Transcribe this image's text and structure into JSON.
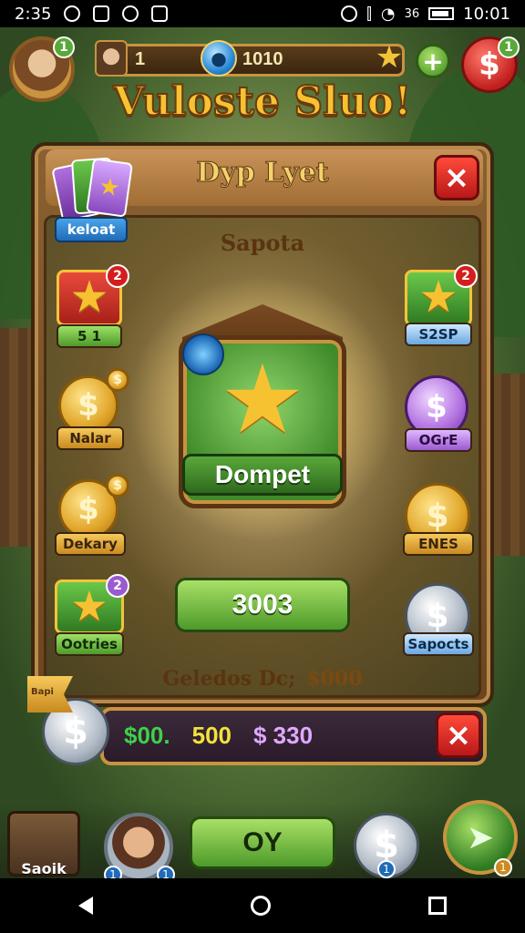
{
  "statusbar": {
    "time": "2:35",
    "clock": "10:01",
    "signal_text": "36"
  },
  "hud": {
    "level": "1",
    "gems": "1010",
    "notif_count": "1",
    "plus_symbol": "+",
    "premium_symbol": "$"
  },
  "title": "Vuloste Sluo!",
  "panel": {
    "title": "Dyp Lyet",
    "subtitle": "Sapota",
    "close_symbol": "×",
    "deck_label": "keloat"
  },
  "items_left": [
    {
      "label": "5  1",
      "badge": "2"
    },
    {
      "label": "Nalar",
      "symbol": "$"
    },
    {
      "label": "Dekary",
      "symbol": "$"
    },
    {
      "label": "Ootries",
      "badge": "2"
    }
  ],
  "items_right": [
    {
      "label": "S2SP",
      "badge": "2"
    },
    {
      "label": "OGrE",
      "symbol": "$"
    },
    {
      "label": "ENES",
      "symbol": "$"
    },
    {
      "label": "Sapocts",
      "symbol": "$"
    }
  ],
  "reward": {
    "label": "Dompet",
    "button": "3003"
  },
  "footer": {
    "text": "Geledos Dc;",
    "value": "$000"
  },
  "info_bar": {
    "val_green": "$00.",
    "val_yellow": "500",
    "val_purple": "$ 330",
    "close_symbol": "×",
    "ribbon": "Bapi"
  },
  "bottom_nav": {
    "sack_label": "Saoik",
    "ok_label": "OY",
    "badge_left": "1",
    "badge_right": "1",
    "coin_symbol": "$",
    "go_symbol": "➤",
    "corner_badge": "1"
  },
  "colors": {
    "gold": "#f6c232",
    "green_btn": "#4e9a2a",
    "red_btn": "#c21e1e",
    "val_green": "#3fd04a",
    "val_yellow": "#f3e23a",
    "val_purple": "#e0a8ff"
  }
}
